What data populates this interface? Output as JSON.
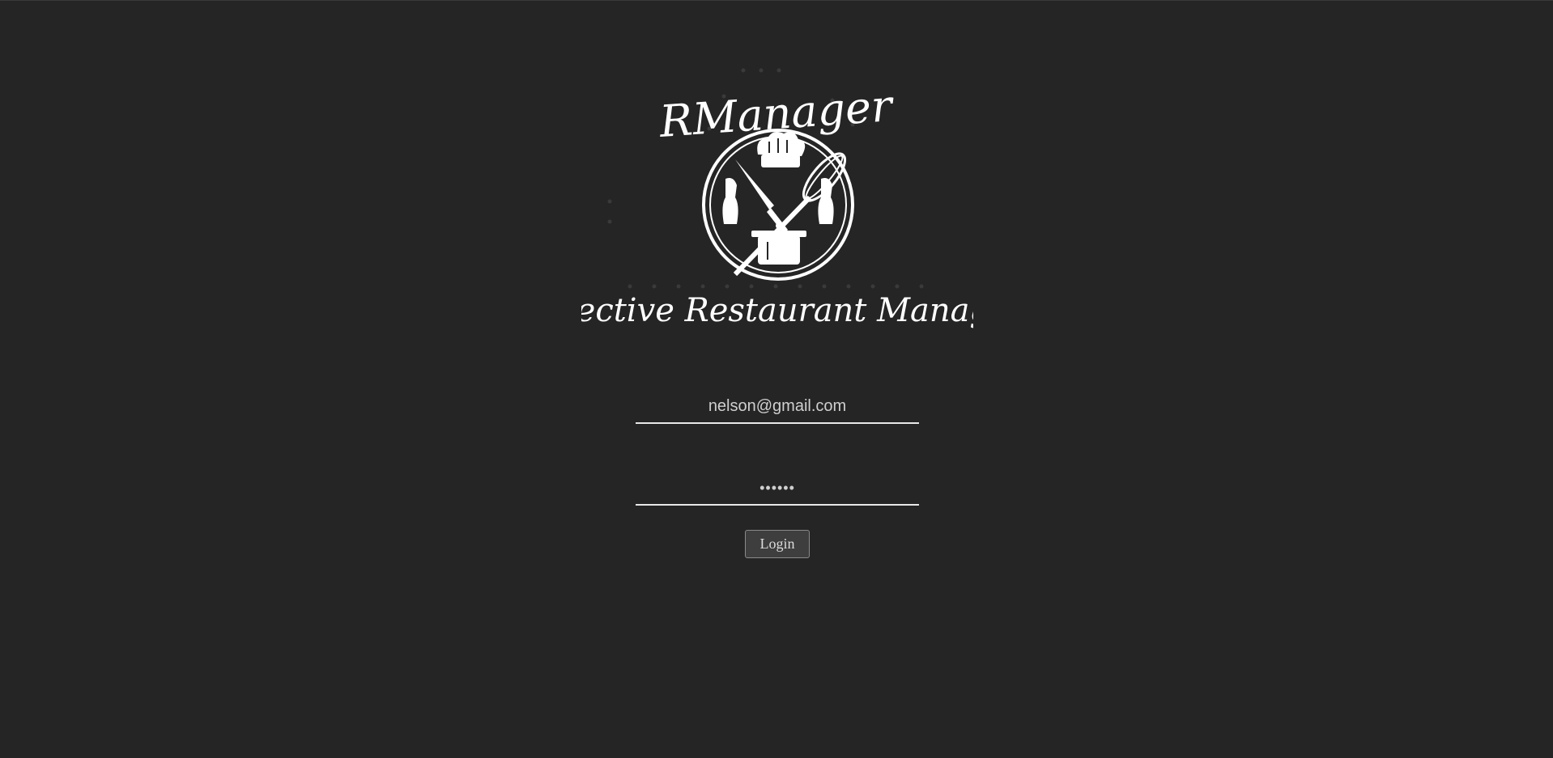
{
  "logo": {
    "brand_name": "RManager",
    "tagline": "Effective Restaurant Manager",
    "emblem_icon": "chef-utensils-emblem-icon"
  },
  "login_form": {
    "email_value": "nelson@gmail.com",
    "password_value": "••••••",
    "login_label": "Login"
  },
  "colors": {
    "background": "#252525",
    "foreground": "#ffffff",
    "button_bg": "#3e3e3e"
  }
}
